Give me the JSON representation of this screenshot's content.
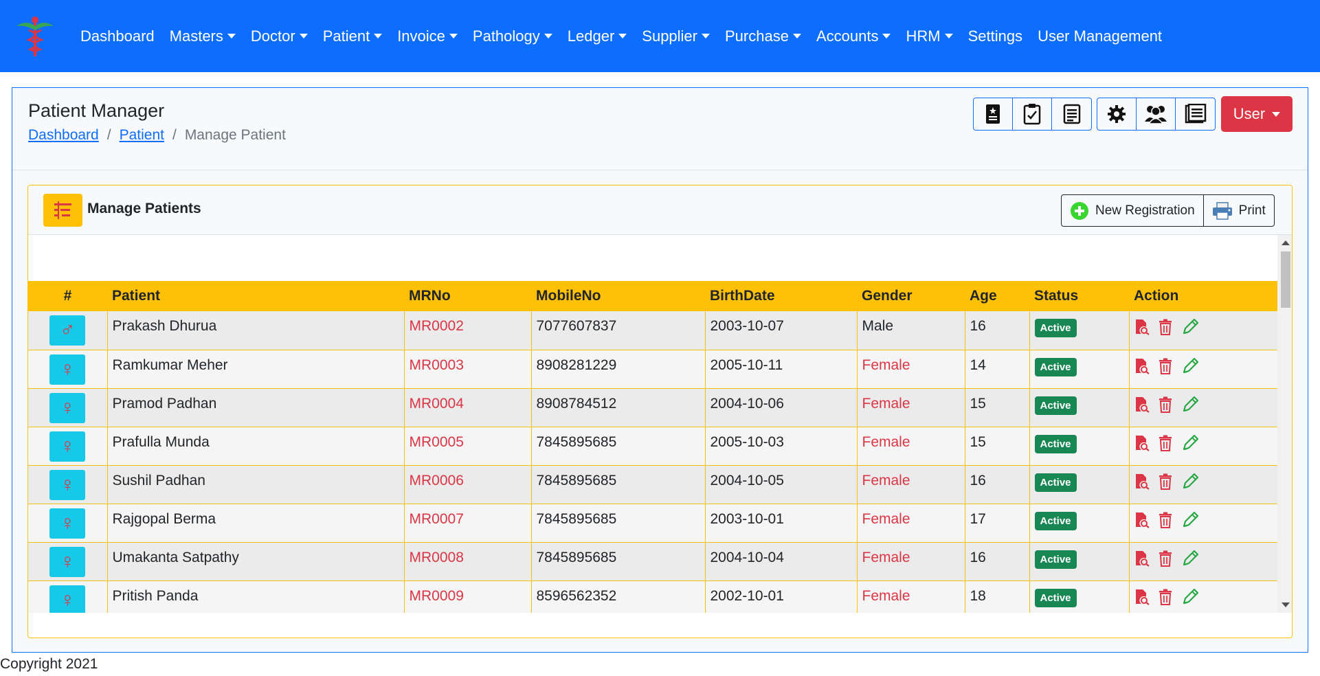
{
  "nav": {
    "items": [
      {
        "label": "Dashboard",
        "dropdown": false
      },
      {
        "label": "Masters",
        "dropdown": true
      },
      {
        "label": "Doctor",
        "dropdown": true
      },
      {
        "label": "Patient",
        "dropdown": true
      },
      {
        "label": "Invoice",
        "dropdown": true
      },
      {
        "label": "Pathology",
        "dropdown": true
      },
      {
        "label": "Ledger",
        "dropdown": true
      },
      {
        "label": "Supplier",
        "dropdown": true
      },
      {
        "label": "Purchase",
        "dropdown": true
      },
      {
        "label": "Accounts",
        "dropdown": true
      },
      {
        "label": "HRM",
        "dropdown": true
      },
      {
        "label": "Settings",
        "dropdown": false
      },
      {
        "label": "User Management",
        "dropdown": false
      }
    ]
  },
  "header": {
    "title": "Patient Manager",
    "breadcrumb": [
      "Dashboard",
      "Patient",
      "Manage Patient"
    ],
    "user_label": "User"
  },
  "panel": {
    "title": "Manage Patients",
    "new_registration_label": "New Registration",
    "print_label": "Print"
  },
  "table": {
    "columns": [
      "#",
      "Patient",
      "MRNo",
      "MobileNo",
      "BirthDate",
      "Gender",
      "Age",
      "Status",
      "Action"
    ],
    "rows": [
      {
        "gender_symbol": "♂",
        "patient": "Prakash Dhurua",
        "mrno": "MR0002",
        "mobile": "7077607837",
        "birthdate": "2003-10-07",
        "gender": "Male",
        "age": "16",
        "status": "Active"
      },
      {
        "gender_symbol": "♀",
        "patient": "Ramkumar Meher",
        "mrno": "MR0003",
        "mobile": "8908281229",
        "birthdate": "2005-10-11",
        "gender": "Female",
        "age": "14",
        "status": "Active"
      },
      {
        "gender_symbol": "♀",
        "patient": "Pramod Padhan",
        "mrno": "MR0004",
        "mobile": "8908784512",
        "birthdate": "2004-10-06",
        "gender": "Female",
        "age": "15",
        "status": "Active"
      },
      {
        "gender_symbol": "♀",
        "patient": "Prafulla Munda",
        "mrno": "MR0005",
        "mobile": "7845895685",
        "birthdate": "2005-10-03",
        "gender": "Female",
        "age": "15",
        "status": "Active"
      },
      {
        "gender_symbol": "♀",
        "patient": "Sushil Padhan",
        "mrno": "MR0006",
        "mobile": "7845895685",
        "birthdate": "2004-10-05",
        "gender": "Female",
        "age": "16",
        "status": "Active"
      },
      {
        "gender_symbol": "♀",
        "patient": "Rajgopal Berma",
        "mrno": "MR0007",
        "mobile": "7845895685",
        "birthdate": "2003-10-01",
        "gender": "Female",
        "age": "17",
        "status": "Active"
      },
      {
        "gender_symbol": "♀",
        "patient": "Umakanta Satpathy",
        "mrno": "MR0008",
        "mobile": "7845895685",
        "birthdate": "2004-10-04",
        "gender": "Female",
        "age": "16",
        "status": "Active"
      },
      {
        "gender_symbol": "♀",
        "patient": "Pritish Panda",
        "mrno": "MR0009",
        "mobile": "8596562352",
        "birthdate": "2002-10-01",
        "gender": "Female",
        "age": "18",
        "status": "Active"
      }
    ]
  },
  "footer": {
    "copyright": "Copyright 2021"
  },
  "colors": {
    "navbar": "#0d6efd",
    "table_header": "#ffc107",
    "danger": "#dc3545",
    "success": "#198754",
    "gender_box": "#17c9e8",
    "edit_icon": "#28a745"
  }
}
